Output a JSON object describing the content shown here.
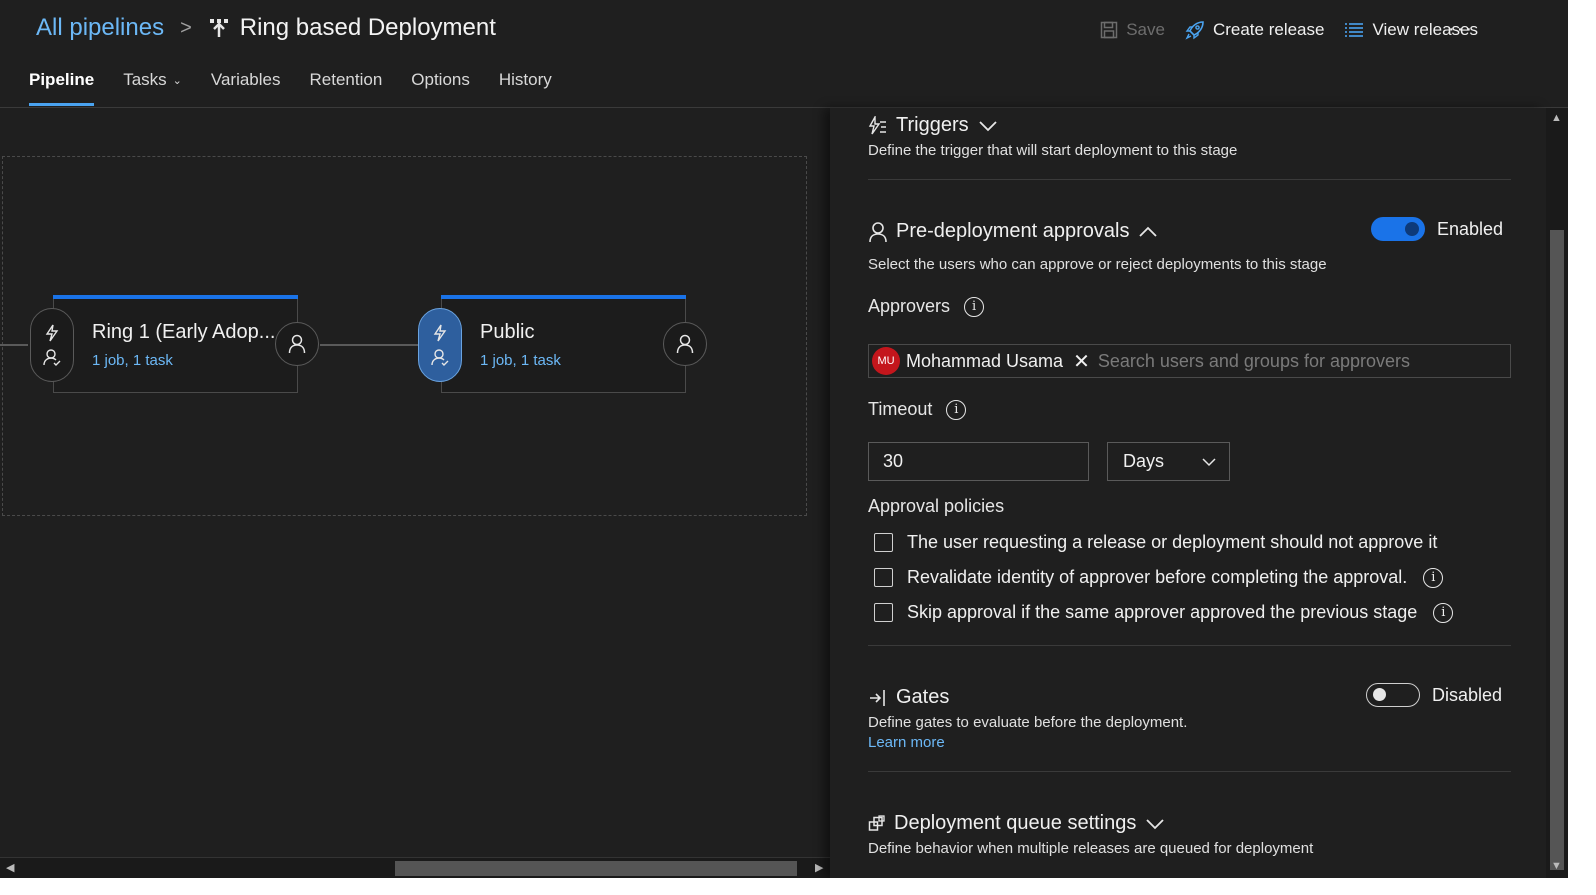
{
  "breadcrumb": {
    "root": "All pipelines",
    "separator": ">",
    "title": "Ring based Deployment",
    "title_icon": "pipeline-icon"
  },
  "toolbar": {
    "save_label": "Save",
    "create_release_label": "Create release",
    "view_releases_label": "View releases",
    "more_label": "···"
  },
  "tabs": [
    {
      "label": "Pipeline",
      "active": true
    },
    {
      "label": "Tasks",
      "dropdown": true
    },
    {
      "label": "Variables"
    },
    {
      "label": "Retention"
    },
    {
      "label": "Options"
    },
    {
      "label": "History"
    }
  ],
  "stages": [
    {
      "name": "Ring 1 (Early Adop...",
      "summary": "1 job, 1 task",
      "selected": false
    },
    {
      "name": "Public",
      "summary": "1 job, 1 task",
      "selected": true
    }
  ],
  "panel": {
    "triggers": {
      "title": "Triggers",
      "description": "Define the trigger that will start deployment to this stage"
    },
    "approvals": {
      "title": "Pre-deployment approvals",
      "toggle_label": "Enabled",
      "description": "Select the users who can approve or reject deployments to this stage",
      "approvers_label": "Approvers",
      "approver": {
        "initials": "MU",
        "name": "Mohammad Usama"
      },
      "search_placeholder": "Search users and groups for approvers",
      "timeout_label": "Timeout",
      "timeout_value": "30",
      "timeout_unit": "Days",
      "policies_label": "Approval policies",
      "policies": [
        {
          "label": "The user requesting a release or deployment should not approve it",
          "checked": false,
          "info": false
        },
        {
          "label": "Revalidate identity of approver before completing the approval.",
          "checked": false,
          "info": true
        },
        {
          "label": "Skip approval if the same approver approved the previous stage",
          "checked": false,
          "info": true
        }
      ]
    },
    "gates": {
      "title": "Gates",
      "toggle_label": "Disabled",
      "description": "Define gates to evaluate before the deployment.",
      "learn_more": "Learn more"
    },
    "queue": {
      "title": "Deployment queue settings",
      "description": "Define behavior when multiple releases are queued for deployment"
    }
  },
  "colors": {
    "accent": "#1a73e8",
    "link": "#6cb8f6",
    "avatar": "#c4161c",
    "background": "#1f1f1f"
  }
}
